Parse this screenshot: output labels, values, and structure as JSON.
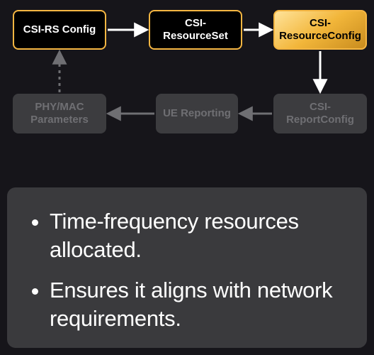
{
  "diagram": {
    "nodes": {
      "csi_rs_config": {
        "label": "CSI-RS Config",
        "style": "active-outline"
      },
      "csi_resourceset": {
        "label": "CSI-ResourceSet",
        "style": "active-outline"
      },
      "csi_resourceconfig": {
        "label": "CSI-ResourceConfig",
        "style": "active-fill"
      },
      "phy_mac": {
        "label": "PHY/MAC Parameters",
        "style": "dim"
      },
      "ue_reporting": {
        "label": "UE Reporting",
        "style": "dim"
      },
      "csi_reportconfig": {
        "label": "CSI-ReportConfig",
        "style": "dim"
      }
    },
    "edges": [
      {
        "from": "csi_rs_config",
        "to": "csi_resourceset",
        "style": "solid-white"
      },
      {
        "from": "csi_resourceset",
        "to": "csi_resourceconfig",
        "style": "solid-white"
      },
      {
        "from": "csi_resourceconfig",
        "to": "csi_reportconfig",
        "style": "solid-white"
      },
      {
        "from": "csi_reportconfig",
        "to": "ue_reporting",
        "style": "solid-dim"
      },
      {
        "from": "ue_reporting",
        "to": "phy_mac",
        "style": "solid-dim"
      },
      {
        "from": "phy_mac",
        "to": "csi_rs_config",
        "style": "dotted-dim"
      }
    ]
  },
  "bullets": {
    "items": [
      "Time-frequency resources allocated.",
      "Ensures it aligns with network requirements."
    ]
  },
  "colors": {
    "bg": "#16151a",
    "accent": "#f5b642",
    "dim_box": "#3c3c3f",
    "dim_text": "#6f6f73",
    "panel": "#3a3a3d",
    "arrow_light": "#ffffff",
    "arrow_dim": "#6f6f73"
  },
  "chart_data": {
    "type": "flow-diagram",
    "nodes": [
      {
        "id": "csi_rs_config",
        "label": "CSI-RS Config",
        "highlight": "outline"
      },
      {
        "id": "csi_resourceset",
        "label": "CSI-ResourceSet",
        "highlight": "outline"
      },
      {
        "id": "csi_resourceconfig",
        "label": "CSI-ResourceConfig",
        "highlight": "fill"
      },
      {
        "id": "csi_reportconfig",
        "label": "CSI-ReportConfig",
        "highlight": "none"
      },
      {
        "id": "ue_reporting",
        "label": "UE Reporting",
        "highlight": "none"
      },
      {
        "id": "phy_mac",
        "label": "PHY/MAC Parameters",
        "highlight": "none"
      }
    ],
    "edges": [
      {
        "from": "csi_rs_config",
        "to": "csi_resourceset",
        "dashed": false
      },
      {
        "from": "csi_resourceset",
        "to": "csi_resourceconfig",
        "dashed": false
      },
      {
        "from": "csi_resourceconfig",
        "to": "csi_reportconfig",
        "dashed": false
      },
      {
        "from": "csi_reportconfig",
        "to": "ue_reporting",
        "dashed": false
      },
      {
        "from": "ue_reporting",
        "to": "phy_mac",
        "dashed": false
      },
      {
        "from": "phy_mac",
        "to": "csi_rs_config",
        "dashed": true
      }
    ]
  }
}
